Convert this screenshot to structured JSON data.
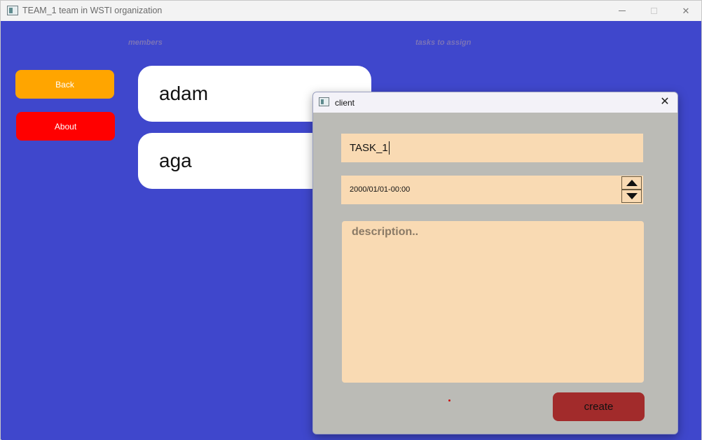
{
  "main_window": {
    "title": "TEAM_1 team in WSTI organization",
    "icon": "app-window-icon",
    "controls": [
      "minimize",
      "maximize",
      "close"
    ]
  },
  "headers": {
    "members": "members",
    "tasks": "tasks to assign"
  },
  "sidebar": {
    "back_label": "Back",
    "about_label": "About"
  },
  "members": [
    {
      "name": "adam"
    },
    {
      "name": "aga"
    }
  ],
  "dialog": {
    "title": "client",
    "task_name_value": "TASK_1",
    "date_value": "2000/01/01-00:00",
    "description_placeholder": "description..",
    "create_label": "create"
  },
  "colors": {
    "background": "#3f47cc",
    "back_button": "#ffa500",
    "about_button": "#ff0000",
    "field": "#f9dab3",
    "dialog_body": "#bbbbb6",
    "create_button": "#a22b2b"
  }
}
